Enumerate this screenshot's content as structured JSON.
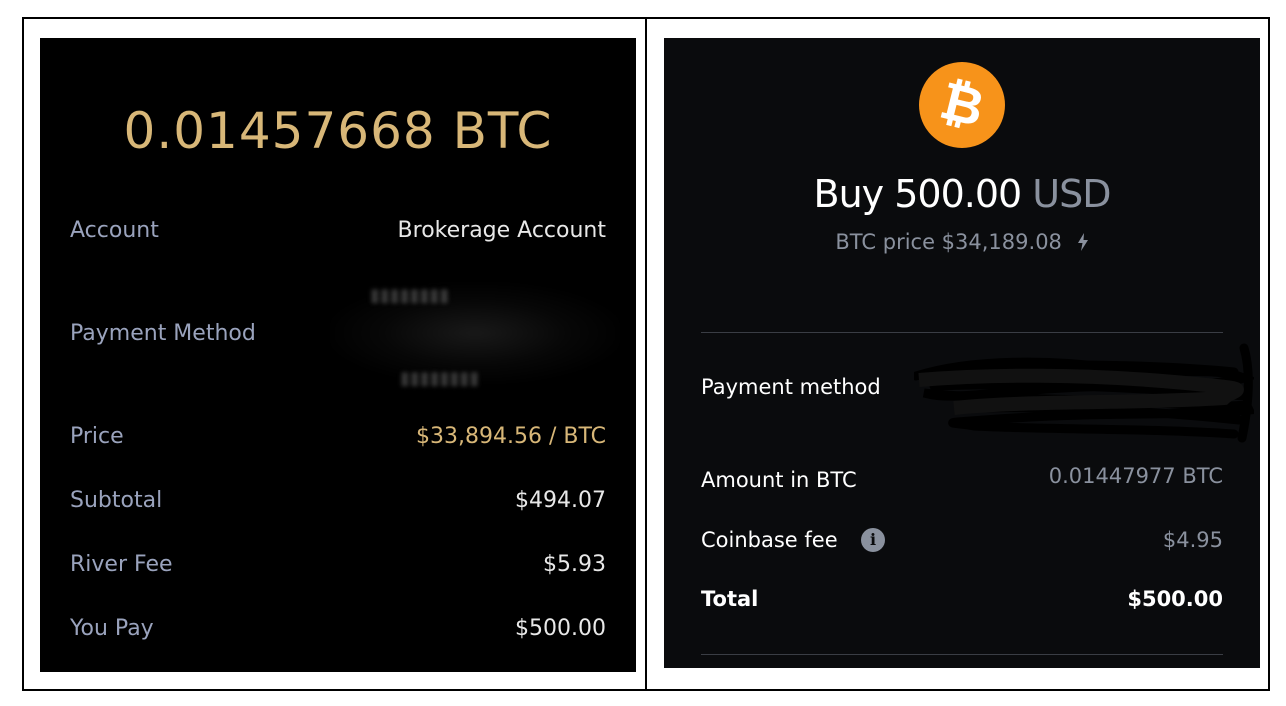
{
  "left_panel": {
    "btc_amount": "0.01457668 BTC",
    "rows": [
      {
        "label": "Account",
        "value": "Brokerage Account"
      },
      {
        "label": "Payment Method",
        "value": ""
      },
      {
        "label": "Price",
        "value": "$33,894.56 / BTC"
      },
      {
        "label": "Subtotal",
        "value": "$494.07"
      },
      {
        "label": "River Fee",
        "value": "$5.93"
      },
      {
        "label": "You Pay",
        "value": "$500.00"
      }
    ],
    "colors": {
      "accent_gold": "#d8b778",
      "label_gray": "#9aa3bd",
      "background": "#000000"
    }
  },
  "right_panel": {
    "logo_icon": "bitcoin-icon",
    "logo_glyph": "₿",
    "buy_prefix": "Buy 500.00",
    "buy_currency": "USD",
    "btc_price": "BTC price $34,189.08",
    "price_icon": "lightning-icon",
    "rows": [
      {
        "label": "Payment method",
        "value": ""
      },
      {
        "label": "Amount in BTC",
        "value": "0.01447977 BTC"
      },
      {
        "label": "Coinbase fee",
        "value": "$4.95"
      },
      {
        "label": "Total",
        "value": "$500.00"
      }
    ],
    "info_icon_glyph": "i",
    "colors": {
      "bitcoin_orange": "#f7931a",
      "muted": "#8a919e",
      "background": "#0a0b0d"
    }
  }
}
